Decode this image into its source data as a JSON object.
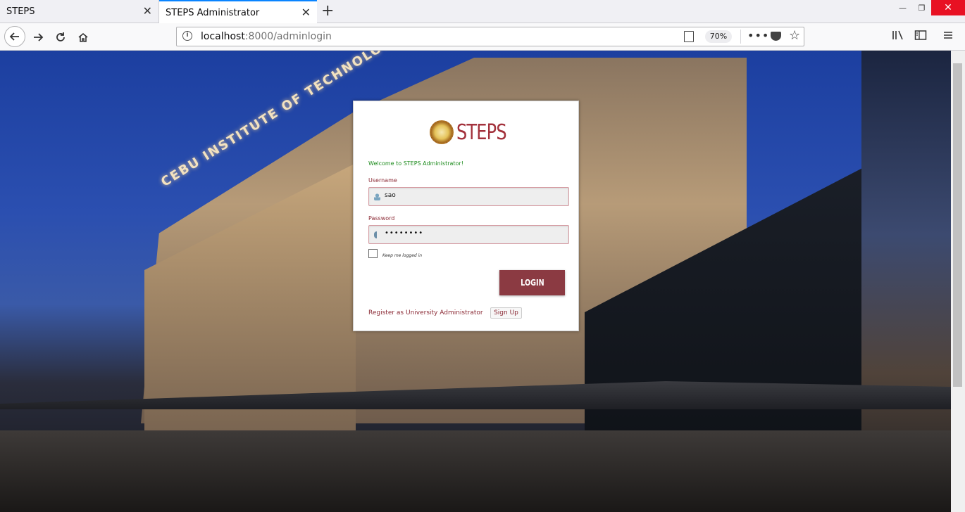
{
  "browser": {
    "tabs": [
      {
        "title": "STEPS",
        "close": "✕"
      },
      {
        "title": "STEPS Administrator",
        "close": "✕"
      }
    ],
    "new_tab": "+",
    "window_controls": {
      "minimize": "—",
      "restore": "❐",
      "close": "✕"
    },
    "url_host": "localhost",
    "url_path": ":8000/adminlogin",
    "zoom": "70%",
    "more": "•••",
    "icons": [
      "back-icon",
      "forward-icon",
      "reload-icon",
      "home-icon",
      "info-icon",
      "reader-view-icon",
      "pocket-icon",
      "bookmark-star-icon",
      "library-icon",
      "sidebar-icon",
      "menu-icon"
    ]
  },
  "background": {
    "sign_text": "CEBU INSTITUTE OF TECHNOLOGY"
  },
  "login": {
    "brand": "STEPS",
    "welcome": "Welcome to STEPS Administrator!",
    "username_label": "Username",
    "username_value": "sao",
    "password_label": "Password",
    "password_value": "••••••••",
    "keep_logged_in": "Keep me logged in",
    "login_button": "LOGIN",
    "register_text": "Register as University Administrator",
    "signup_button": "Sign Up"
  },
  "colors": {
    "accent": "#8b3a42",
    "welcome_green": "#1a8a1a",
    "tab_active": "#0a84ff"
  }
}
